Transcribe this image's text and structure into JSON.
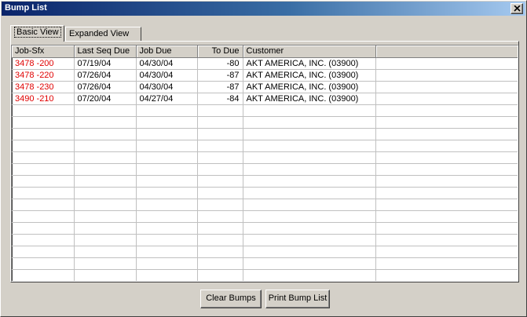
{
  "window": {
    "title": "Bump List"
  },
  "tabs": [
    {
      "label": "Basic View",
      "active": true
    },
    {
      "label": "Expanded View",
      "active": false
    }
  ],
  "table": {
    "columns": [
      "Job-Sfx",
      "Last Seq Due",
      "Job Due",
      "To Due",
      "Customer",
      ""
    ],
    "rows": [
      [
        "3478  -200",
        "07/19/04",
        "04/30/04",
        "-80",
        "AKT AMERICA, INC. (03900)"
      ],
      [
        "3478  -220",
        "07/26/04",
        "04/30/04",
        "-87",
        "AKT AMERICA, INC. (03900)"
      ],
      [
        "3478  -230",
        "07/26/04",
        "04/30/04",
        "-87",
        "AKT AMERICA, INC. (03900)"
      ],
      [
        "3490  -210",
        "07/20/04",
        "04/27/04",
        "-84",
        "AKT AMERICA, INC. (03900)"
      ]
    ]
  },
  "buttons": {
    "clear": "Clear Bumps",
    "print": "Print Bump List"
  },
  "colors": {
    "job_text": "#e00000",
    "title_bar": "#0a246a",
    "face": "#d4d0c8"
  },
  "icons": {
    "close": "close-icon"
  }
}
